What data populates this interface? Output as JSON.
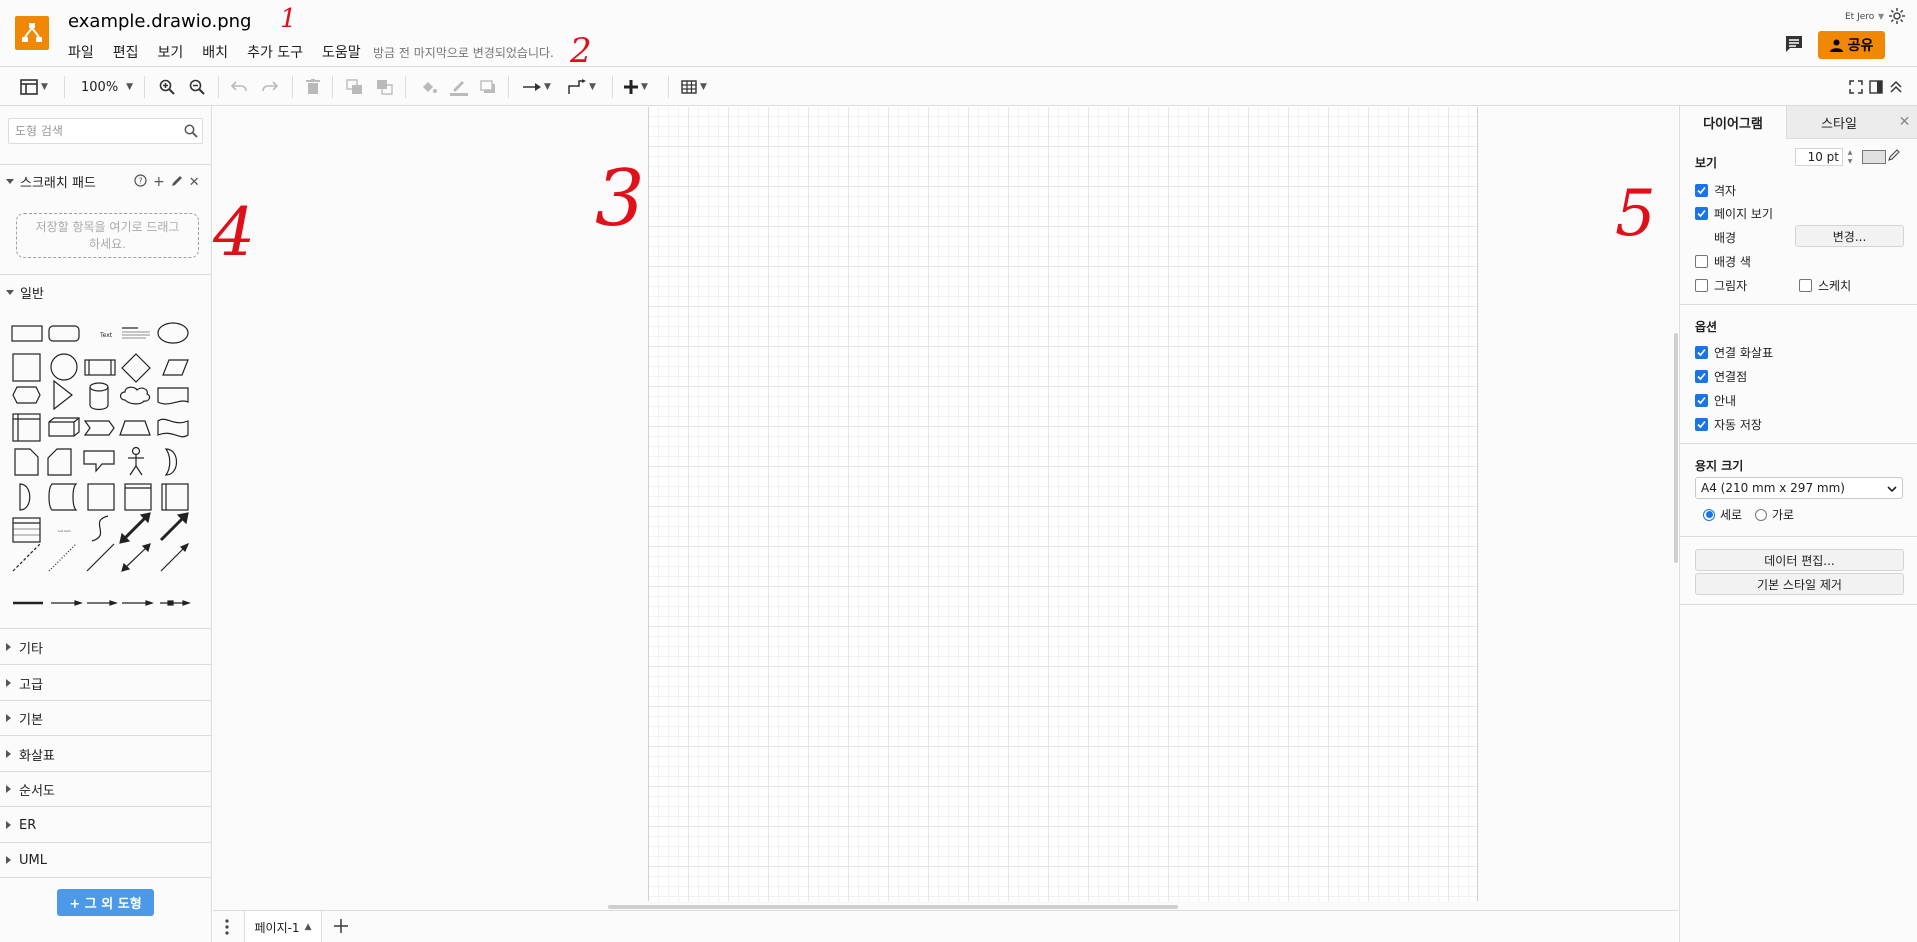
{
  "header": {
    "filename": "example.drawio.png",
    "menu": [
      "파일",
      "편집",
      "보기",
      "배치",
      "추가 도구",
      "도움말"
    ],
    "save_status": "방금 전 마지막으로 변경되었습니다.",
    "user": "Et Jero",
    "share_label": "공유",
    "accent_color": "#f08705"
  },
  "toolbar": {
    "zoom": "100%",
    "icons": [
      "view-layout-icon",
      "zoom-in-icon",
      "zoom-out-icon",
      "undo-icon",
      "redo-icon",
      "delete-icon",
      "to-front-icon",
      "to-back-icon",
      "fill-color-icon",
      "line-color-icon",
      "shadow-icon",
      "connection-icon",
      "waypoints-icon",
      "insert-icon",
      "table-icon",
      "fullscreen-icon",
      "format-panel-icon",
      "collapse-icon"
    ]
  },
  "sidebar": {
    "search_placeholder": "도형 검색",
    "scratchpad": {
      "title": "스크래치 패드",
      "drop_hint_line1": "저장할 항목을 여기로 드래그",
      "drop_hint_line2": "하세요."
    },
    "general_title": "일반",
    "sections": [
      "기타",
      "고급",
      "기본",
      "화살표",
      "순서도",
      "ER",
      "UML"
    ],
    "more_shapes_label": "+ 그 외 도형"
  },
  "page_tabs": {
    "current": "페이지-1"
  },
  "format_panel": {
    "tabs": [
      "다이어그램",
      "스타일"
    ],
    "view_title": "보기",
    "grid": {
      "label": "격자",
      "checked": true,
      "size": "10 pt"
    },
    "page_view": {
      "label": "페이지 보기",
      "checked": true
    },
    "background": {
      "label": "배경",
      "button": "변경..."
    },
    "background_color": {
      "label": "배경 색",
      "checked": false
    },
    "shadow": {
      "label": "그림자",
      "checked": false
    },
    "sketch": {
      "label": "스케치",
      "checked": false
    },
    "options_title": "옵션",
    "options": [
      {
        "label": "연결 화살표",
        "checked": true
      },
      {
        "label": "연결점",
        "checked": true
      },
      {
        "label": "안내",
        "checked": true
      },
      {
        "label": "자동 저장",
        "checked": true
      }
    ],
    "paper_title": "용지 크기",
    "paper_size": "A4 (210 mm x 297 mm)",
    "orientation": {
      "portrait": "세로",
      "landscape": "가로",
      "selected": "portrait"
    },
    "edit_data_button": "데이터 편집...",
    "clear_style_button": "기본 스타일 제거"
  },
  "annotations": [
    "1",
    "2",
    "3",
    "4",
    "5"
  ]
}
